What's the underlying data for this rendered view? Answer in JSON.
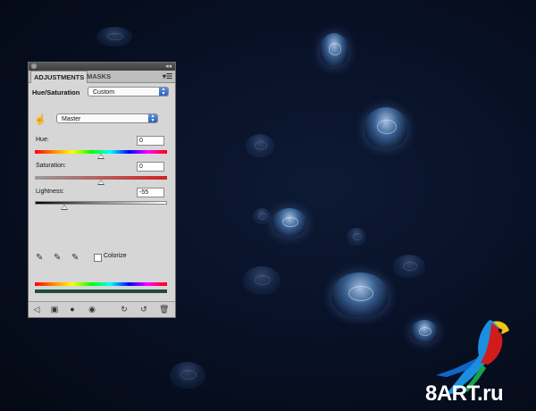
{
  "panel": {
    "tabs": [
      {
        "label": "ADJUSTMENTS",
        "active": true
      },
      {
        "label": "MASKS",
        "active": false
      }
    ],
    "adjustment_name": "Hue/Saturation",
    "preset": {
      "selected": "Custom"
    },
    "channel": {
      "selected": "Master"
    },
    "hue": {
      "label": "Hue:",
      "value": "0",
      "slider_fraction": 0.5
    },
    "saturation": {
      "label": "Saturation:",
      "value": "0",
      "slider_fraction": 0.5
    },
    "lightness": {
      "label": "Lightness:",
      "value": "-55",
      "slider_fraction": 0.225
    },
    "colorize": {
      "label": "Colorize",
      "checked": false
    },
    "icons": [
      "eyedropper-icon",
      "eyedropper-plus-icon",
      "eyedropper-minus-icon",
      "hand-target-icon",
      "back-arrow-icon",
      "clip-layer-icon",
      "visibility-mask-icon",
      "eye-icon",
      "previous-state-icon",
      "reset-icon",
      "trash-icon",
      "panel-menu-icon"
    ]
  },
  "watermark": {
    "text": "8ART.ru"
  },
  "colors": {
    "panel_bg": "#d6d6d6",
    "background": "#081127",
    "accent": "#2d5fc0"
  }
}
